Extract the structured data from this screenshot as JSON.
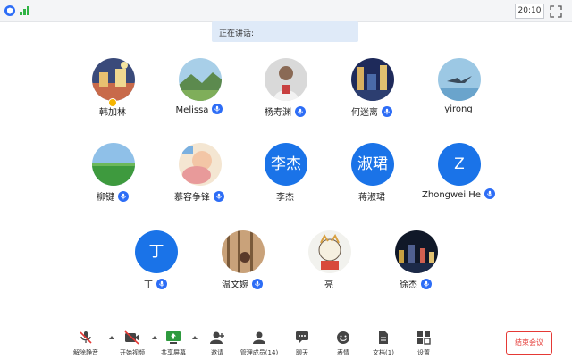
{
  "topbar": {
    "time": "20:10"
  },
  "speaking_label": "正在讲话:",
  "participants": [
    {
      "name": "韩加林",
      "avatar": "photo-city-night",
      "mic": false,
      "host_badge": true
    },
    {
      "name": "Melissa",
      "avatar": "photo-landscape",
      "mic": true
    },
    {
      "name": "杨寿渊",
      "avatar": "photo-person",
      "mic": true
    },
    {
      "name": "何迷离",
      "avatar": "photo-night-city",
      "mic": true
    },
    {
      "name": "yirong",
      "avatar": "photo-seagull",
      "mic": false
    },
    {
      "name": "柳键",
      "avatar": "photo-grassland",
      "mic": true
    },
    {
      "name": "慕容争锋",
      "avatar": "photo-baby",
      "mic": true
    },
    {
      "name": "李杰",
      "avatar_text": "李杰",
      "mic": false
    },
    {
      "name": "蒋淑珺",
      "avatar_text": "淑珺",
      "mic": false
    },
    {
      "name": "Zhongwei He",
      "avatar_text": "Z",
      "mic": true
    },
    {
      "name": "丁",
      "avatar_text": "丁",
      "mic": true
    },
    {
      "name": "温文婉",
      "avatar": "photo-forest",
      "mic": true
    },
    {
      "name": "亮",
      "avatar": "photo-cartoon",
      "mic": false
    },
    {
      "name": "徐杰",
      "avatar": "photo-night",
      "mic": true
    }
  ],
  "toolbar": {
    "unmute": "解除静音",
    "start_video": "开始视频",
    "share_screen": "共享屏幕",
    "invite": "邀请",
    "manage_members": "管理成员(14)",
    "chat": "聊天",
    "reactions": "表情",
    "docs": "文档(1)",
    "settings": "设置",
    "end_meeting": "结束会议"
  },
  "colors": {
    "accent": "#1a73e8",
    "mic_badge": "#2d6df6",
    "end": "#e53935",
    "signal": "#2fb344"
  }
}
